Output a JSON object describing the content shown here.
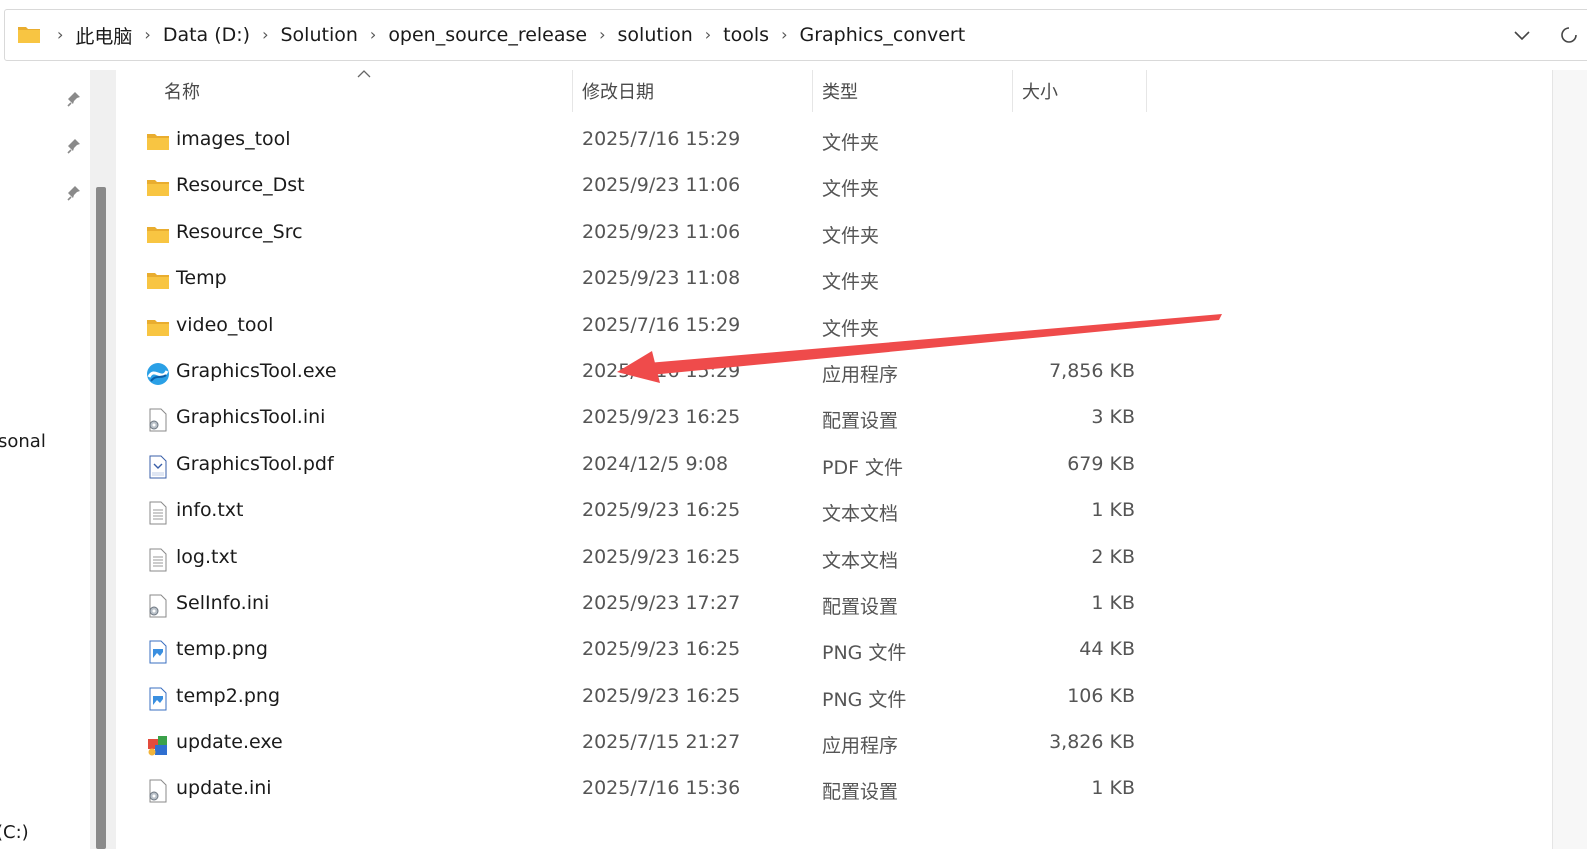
{
  "address_bar": {
    "breadcrumbs": [
      "此电脑",
      "Data (D:)",
      "Solution",
      "open_source_release",
      "solution",
      "tools",
      "Graphics_convert"
    ],
    "separator": "›"
  },
  "nav_pane": {
    "partial_labels": [
      "sonal",
      "(C:)"
    ]
  },
  "columns": {
    "name": "名称",
    "date": "修改日期",
    "type": "类型",
    "size": "大小"
  },
  "files": [
    {
      "name": "images_tool",
      "date": "2025/7/16 15:29",
      "type": "文件夹",
      "size": "",
      "icon": "folder-icon"
    },
    {
      "name": "Resource_Dst",
      "date": "2025/9/23 11:06",
      "type": "文件夹",
      "size": "",
      "icon": "folder-icon"
    },
    {
      "name": "Resource_Src",
      "date": "2025/9/23 11:06",
      "type": "文件夹",
      "size": "",
      "icon": "folder-icon"
    },
    {
      "name": "Temp",
      "date": "2025/9/23 11:08",
      "type": "文件夹",
      "size": "",
      "icon": "folder-icon"
    },
    {
      "name": "video_tool",
      "date": "2025/7/16 15:29",
      "type": "文件夹",
      "size": "",
      "icon": "folder-icon"
    },
    {
      "name": "GraphicsTool.exe",
      "date": "2025/7/16 15:29",
      "type": "应用程序",
      "size": "7,856 KB",
      "icon": "graphicstool-app-icon"
    },
    {
      "name": "GraphicsTool.ini",
      "date": "2025/9/23 16:25",
      "type": "配置设置",
      "size": "3 KB",
      "icon": "ini-file-icon"
    },
    {
      "name": "GraphicsTool.pdf",
      "date": "2024/12/5 9:08",
      "type": "PDF 文件",
      "size": "679 KB",
      "icon": "pdf-file-icon"
    },
    {
      "name": "info.txt",
      "date": "2025/9/23 16:25",
      "type": "文本文档",
      "size": "1 KB",
      "icon": "text-file-icon"
    },
    {
      "name": "log.txt",
      "date": "2025/9/23 16:25",
      "type": "文本文档",
      "size": "2 KB",
      "icon": "text-file-icon"
    },
    {
      "name": "SelInfo.ini",
      "date": "2025/9/23 17:27",
      "type": "配置设置",
      "size": "1 KB",
      "icon": "ini-file-icon"
    },
    {
      "name": "temp.png",
      "date": "2025/9/23 16:25",
      "type": "PNG 文件",
      "size": "44 KB",
      "icon": "png-file-icon"
    },
    {
      "name": "temp2.png",
      "date": "2025/9/23 16:25",
      "type": "PNG 文件",
      "size": "106 KB",
      "icon": "png-file-icon"
    },
    {
      "name": "update.exe",
      "date": "2025/7/15 21:27",
      "type": "应用程序",
      "size": "3,826 KB",
      "icon": "update-app-icon"
    },
    {
      "name": "update.ini",
      "date": "2025/7/16 15:36",
      "type": "配置设置",
      "size": "1 KB",
      "icon": "ini-file-icon"
    }
  ],
  "colors": {
    "annotation_arrow": "#ef4b4b",
    "folder": "#f8c542",
    "scrollbar_thumb": "#8a8a8a"
  }
}
